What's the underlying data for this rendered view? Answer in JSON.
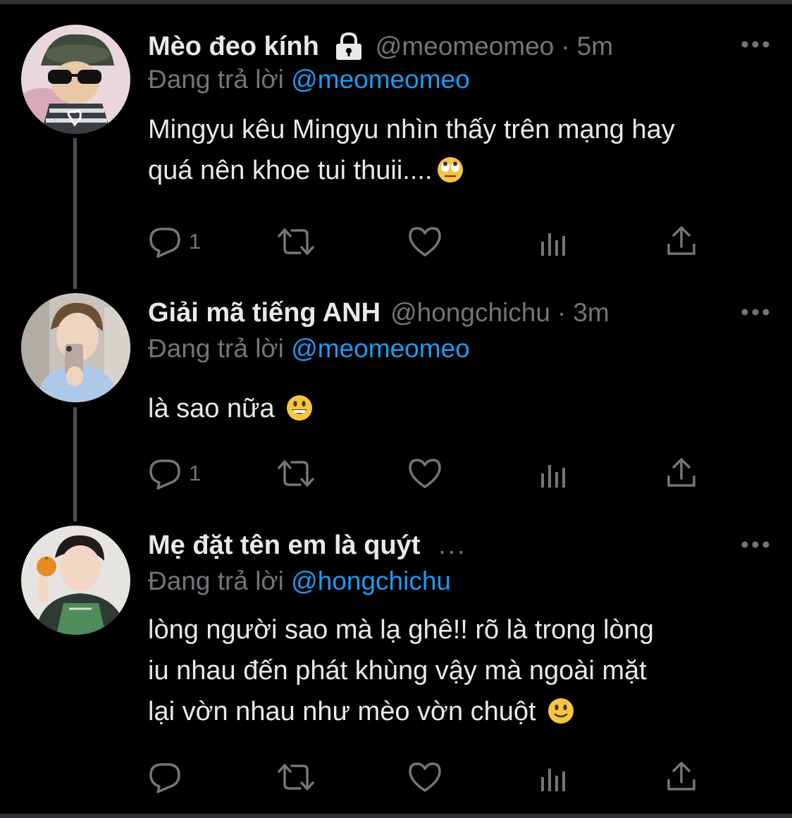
{
  "tweets": [
    {
      "name": "Mèo đeo kính",
      "locked": true,
      "handle": "@meomeomeo",
      "separator": "·",
      "time": "5m",
      "reply_prefix": "Đang trả lời",
      "reply_to": "@meomeomeo",
      "lines": [
        "Mingyu kêu Mingyu nhìn thấy trên mạng hay",
        "quá nên khoe tui thuii...."
      ],
      "emoji": "eye-roll-emoji",
      "reply_count": "1",
      "avatar": "cat-with-sunglasses-avatar"
    },
    {
      "name": "Giải mã tiếng ANH",
      "locked": false,
      "handle": "@hongchichu",
      "separator": "·",
      "time": "3m",
      "reply_prefix": "Đang trả lời",
      "reply_to": "@meomeomeo",
      "lines": [
        "là sao nữa"
      ],
      "emoji": "grinning-emoji",
      "reply_count": "1",
      "avatar": "mirror-selfie-avatar"
    },
    {
      "name": "Mẹ đặt tên em là quýt",
      "name_overflow": "...",
      "locked": false,
      "reply_prefix": "Đang trả lời",
      "reply_to": "@hongchichu",
      "lines": [
        "lòng người sao mà lạ ghê!! rõ là trong lòng",
        "iu nhau đến phát khùng vậy mà ngoài mặt",
        "lại vờn nhau như mèo vờn chuột"
      ],
      "emoji": "slight-smile-emoji",
      "reply_count": "",
      "avatar": "boy-holding-orange-avatar"
    }
  ],
  "colors": {
    "background": "#000000",
    "text": "#e7e9ea",
    "muted": "#71767b",
    "link": "#1d9bf0",
    "thread_line": "#4a4f54"
  }
}
